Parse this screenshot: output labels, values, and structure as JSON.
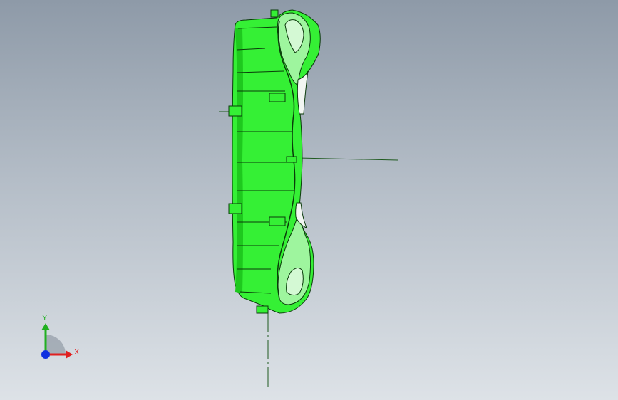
{
  "viewport": {
    "background_top": "#8e9aa8",
    "background_bottom": "#dde2e7"
  },
  "model": {
    "part_color": "#35f035",
    "part_shade_color": "#1ec81e",
    "edge_color": "#0a3a0a",
    "axis_line_color": "#1f5a1f"
  },
  "triad": {
    "x_label": "X",
    "y_label": "Y",
    "x_color": "#e02020",
    "y_color": "#20b020",
    "z_color": "#1030e0",
    "x_icon": "x-axis-arrow-icon",
    "y_icon": "y-axis-arrow-icon",
    "z_icon": "z-axis-dot-icon"
  }
}
